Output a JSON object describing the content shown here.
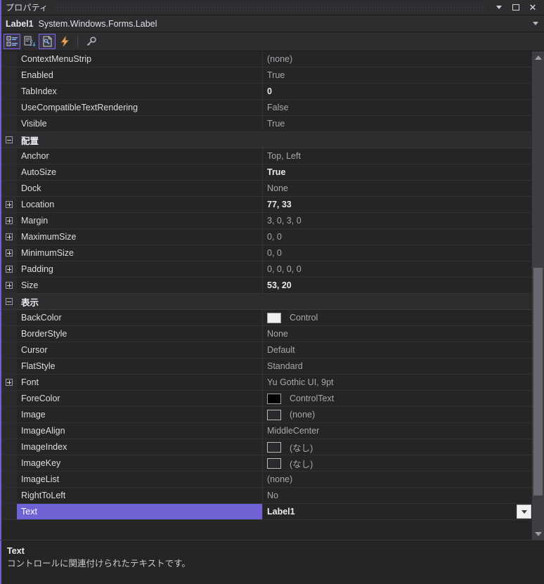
{
  "window": {
    "title": "プロパティ",
    "buttons": {
      "dropdown": "▼",
      "restore": "Restore",
      "close": "✕"
    }
  },
  "object_selector": {
    "name": "Label1",
    "type": "System.Windows.Forms.Label"
  },
  "toolbar": {
    "items": [
      {
        "name": "categorized-view",
        "label": "分類別",
        "active": true
      },
      {
        "name": "alphabetical-view",
        "label": "アルファベット順",
        "active": false
      },
      {
        "name": "property-pages",
        "label": "プロパティ ページ",
        "active": true
      },
      {
        "name": "events-view",
        "label": "イベント",
        "active": false
      },
      {
        "name": "properties-view",
        "label": "プロパティ",
        "active": false
      }
    ]
  },
  "grid": {
    "rows": [
      {
        "kind": "property",
        "expander": "none",
        "name": "ContextMenuStrip",
        "value": "(none)",
        "modified": false
      },
      {
        "kind": "property",
        "expander": "none",
        "name": "Enabled",
        "value": "True",
        "modified": false
      },
      {
        "kind": "property",
        "expander": "none",
        "name": "TabIndex",
        "value": "0",
        "modified": true
      },
      {
        "kind": "property",
        "expander": "none",
        "name": "UseCompatibleTextRendering",
        "value": "False",
        "modified": false
      },
      {
        "kind": "property",
        "expander": "none",
        "name": "Visible",
        "value": "True",
        "modified": false
      },
      {
        "kind": "category",
        "expander": "minus",
        "name": "配置"
      },
      {
        "kind": "property",
        "expander": "none",
        "name": "Anchor",
        "value": "Top, Left",
        "modified": false
      },
      {
        "kind": "property",
        "expander": "none",
        "name": "AutoSize",
        "value": "True",
        "modified": true
      },
      {
        "kind": "property",
        "expander": "none",
        "name": "Dock",
        "value": "None",
        "modified": false
      },
      {
        "kind": "property",
        "expander": "plus",
        "name": "Location",
        "value": "77, 33",
        "modified": true
      },
      {
        "kind": "property",
        "expander": "plus",
        "name": "Margin",
        "value": "3, 0, 3, 0",
        "modified": false
      },
      {
        "kind": "property",
        "expander": "plus",
        "name": "MaximumSize",
        "value": "0, 0",
        "modified": false
      },
      {
        "kind": "property",
        "expander": "plus",
        "name": "MinimumSize",
        "value": "0, 0",
        "modified": false
      },
      {
        "kind": "property",
        "expander": "plus",
        "name": "Padding",
        "value": "0, 0, 0, 0",
        "modified": false
      },
      {
        "kind": "property",
        "expander": "plus",
        "name": "Size",
        "value": "53, 20",
        "modified": true
      },
      {
        "kind": "category",
        "expander": "minus",
        "name": "表示"
      },
      {
        "kind": "property",
        "expander": "none",
        "name": "BackColor",
        "value": "Control",
        "modified": false,
        "swatch": "#f0f0f0"
      },
      {
        "kind": "property",
        "expander": "none",
        "name": "BorderStyle",
        "value": "None",
        "modified": false
      },
      {
        "kind": "property",
        "expander": "none",
        "name": "Cursor",
        "value": "Default",
        "modified": false
      },
      {
        "kind": "property",
        "expander": "none",
        "name": "FlatStyle",
        "value": "Standard",
        "modified": false
      },
      {
        "kind": "property",
        "expander": "plus",
        "name": "Font",
        "value": "Yu Gothic UI, 9pt",
        "modified": false
      },
      {
        "kind": "property",
        "expander": "none",
        "name": "ForeColor",
        "value": "ControlText",
        "modified": false,
        "swatch": "#000000"
      },
      {
        "kind": "property",
        "expander": "none",
        "name": "Image",
        "value": "(none)",
        "modified": false,
        "swatch": "empty"
      },
      {
        "kind": "property",
        "expander": "none",
        "name": "ImageAlign",
        "value": "MiddleCenter",
        "modified": false
      },
      {
        "kind": "property",
        "expander": "none",
        "name": "ImageIndex",
        "value": "(なし)",
        "modified": false,
        "swatch": "empty"
      },
      {
        "kind": "property",
        "expander": "none",
        "name": "ImageKey",
        "value": "(なし)",
        "modified": false,
        "swatch": "empty"
      },
      {
        "kind": "property",
        "expander": "none",
        "name": "ImageList",
        "value": "(none)",
        "modified": false
      },
      {
        "kind": "property",
        "expander": "none",
        "name": "RightToLeft",
        "value": "No",
        "modified": false
      },
      {
        "kind": "property",
        "expander": "none",
        "name": "Text",
        "value": "Label1",
        "modified": true,
        "selected": true,
        "dropdown": true
      }
    ]
  },
  "scrollbar": {
    "up_arrow": "▲",
    "down_arrow": "▼",
    "thumb_top_pct": 44,
    "thumb_height_pct": 49
  },
  "description": {
    "title": "Text",
    "text": "コントロールに関連付けられたテキストです。"
  },
  "colors": {
    "accent": "#6f62d4",
    "selection": "#6f62d4",
    "panel_bg": "#252526",
    "chrome_bg": "#2d2d30",
    "grid_line": "#323236"
  }
}
